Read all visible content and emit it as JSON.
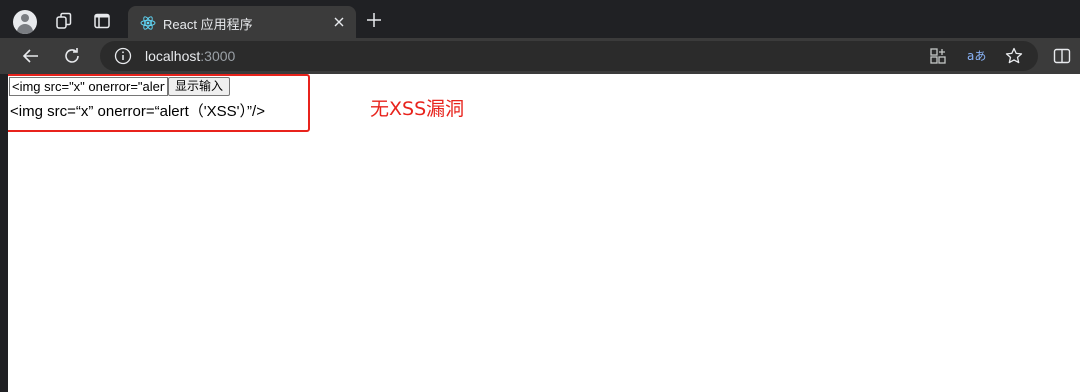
{
  "browser": {
    "tab": {
      "title": "React 应用程序"
    },
    "address_bar": {
      "host": "localhost",
      "port": ":3000"
    }
  },
  "page": {
    "input_value": "<img src=\"x\" onerror=\"alert('XSS')\"/>",
    "button_label": "显示输入",
    "output_text": "<img src=“x” onerror=“alert（'XSS'）”/>"
  },
  "annotation": {
    "text": "无XSS漏洞",
    "color": "#e8231c"
  },
  "colors": {
    "tabstrip": "#202124",
    "toolbar": "#3b3b3b",
    "accent_red": "#e8231c"
  },
  "icons": [
    "profile-avatar",
    "workspaces-icon",
    "tab-actions-icon",
    "react-favicon",
    "close-icon",
    "new-tab-icon",
    "back-icon",
    "refresh-icon",
    "info-icon",
    "app-grid-icon",
    "read-aloud-icon",
    "favorite-star-icon",
    "split-screen-icon"
  ]
}
